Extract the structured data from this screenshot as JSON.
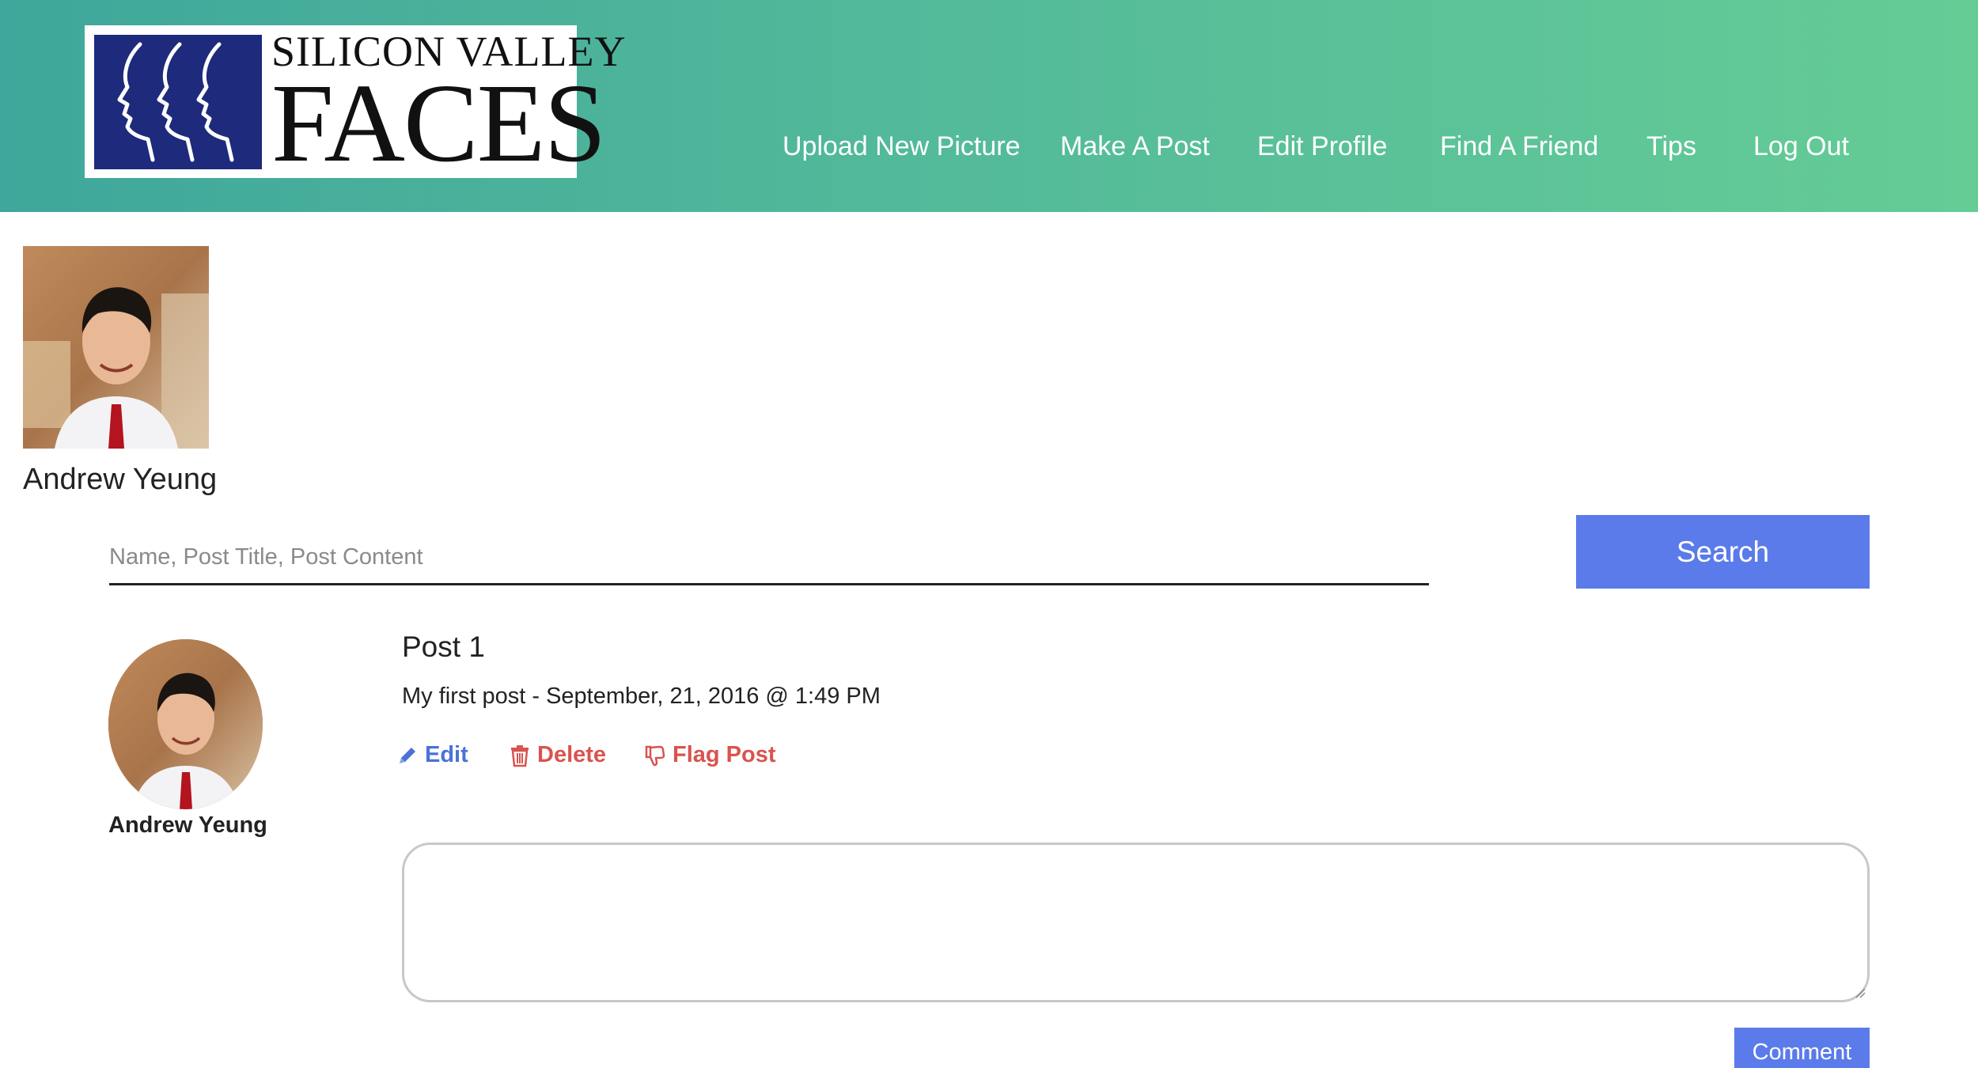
{
  "header": {
    "logo": {
      "line1": "SILICON VALLEY",
      "line2": "FACES"
    },
    "nav": [
      {
        "label": "Upload New Picture"
      },
      {
        "label": "Make A Post"
      },
      {
        "label": "Edit Profile"
      },
      {
        "label": "Find A Friend"
      },
      {
        "label": "Tips"
      },
      {
        "label": "Log Out"
      }
    ]
  },
  "profile": {
    "name": "Andrew Yeung"
  },
  "search": {
    "placeholder": "Name, Post Title, Post Content",
    "value": "",
    "button_label": "Search"
  },
  "post": {
    "author": "Andrew Yeung",
    "title": "Post 1",
    "meta": "My first post - September, 21, 2016 @ 1:49 PM",
    "actions": {
      "edit": "Edit",
      "delete": "Delete",
      "flag": "Flag Post"
    },
    "comment_value": "",
    "comment_button": "Comment"
  },
  "colors": {
    "header_gradient_start": "#3fa79b",
    "header_gradient_end": "#65cc96",
    "primary_button": "#5b7bea",
    "edit_link": "#4a73d8",
    "danger_link": "#d9534f",
    "logo_navy": "#1e2a7c"
  },
  "icons": {
    "edit": "pencil-icon",
    "delete": "trash-icon",
    "flag": "thumbs-down-icon"
  }
}
